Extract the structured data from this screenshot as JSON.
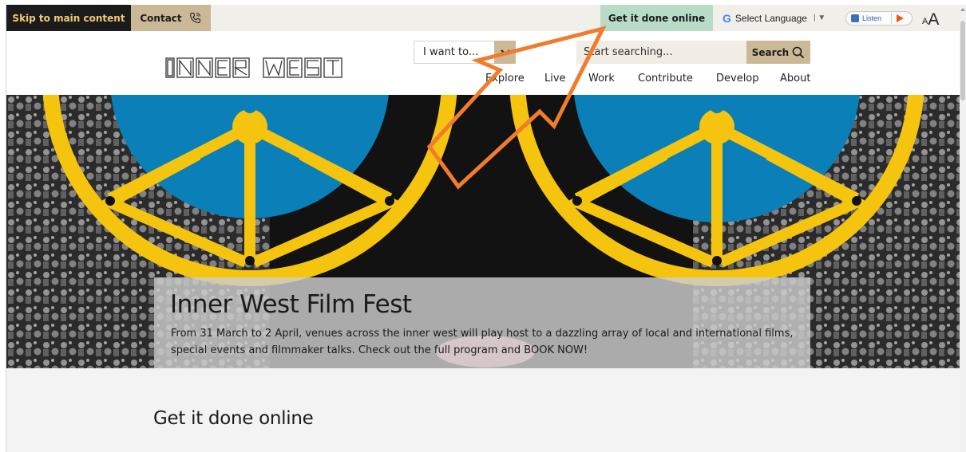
{
  "utility_bar": {
    "skip_link": "Skip to main content",
    "contact": "Contact",
    "get_it_done": "Get it done online",
    "language": "Select Language",
    "listen": "Listen",
    "text_size_small": "A",
    "text_size_large": "A"
  },
  "header": {
    "logo_text": "INNER WEST",
    "i_want_to": "I want to...",
    "search_placeholder": "Start searching...",
    "search_button": "Search",
    "nav": [
      "Explore",
      "Live",
      "Work",
      "Contribute",
      "Develop",
      "About"
    ]
  },
  "hero": {
    "title": "Inner West Film Fest",
    "description": "From 31 March to 2 April, venues across the inner west will play host to a dazzling array of local and international films, special events and filmmaker talks. Check out the full program and BOOK NOW!"
  },
  "section": {
    "heading": "Get it done online"
  },
  "colors": {
    "dark": "#1b1b1b",
    "tan": "#cbb896",
    "mint": "#b9dcc9",
    "reel_yellow": "#f5c40f",
    "reel_blue": "#0b7fb8",
    "annotation_arrow": "#f07c2e"
  }
}
